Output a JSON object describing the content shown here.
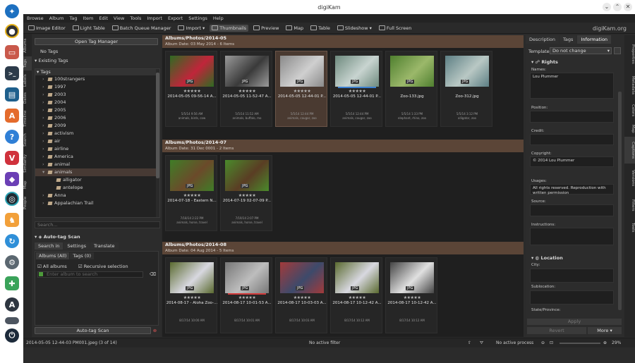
{
  "window": {
    "title": "digiKam"
  },
  "menu": [
    "Browse",
    "Album",
    "Tag",
    "Item",
    "Edit",
    "View",
    "Tools",
    "Import",
    "Export",
    "Settings",
    "Help"
  ],
  "toolbar": {
    "buttons": [
      "Image Editor",
      "Light Table",
      "Batch Queue Manager",
      "Import",
      "Thumbnails",
      "Preview",
      "Map",
      "Table",
      "Slideshow",
      "Full Screen"
    ],
    "brand": "digiKam.org"
  },
  "left_vtabs": [
    "Albums",
    "Tags",
    "Labels",
    "Dates",
    "Timeline",
    "Search",
    "Similarity",
    "Map",
    "People"
  ],
  "left_panel": {
    "open_tag_manager": "Open Tag Manager",
    "no_tags": "No Tags",
    "existing_tags": "Existing Tags",
    "tags_header": "Tags",
    "tags": [
      "100strangers",
      "1997",
      "2003",
      "2004",
      "2005",
      "2006",
      "2009",
      "activism",
      "air",
      "airline",
      "America",
      "animal",
      "animals",
      "alligator",
      "antelope",
      "Anna",
      "Appalachian Trail"
    ],
    "search_placeholder": "Search...",
    "auto_tag": {
      "title": "Auto-tag Scan",
      "tabs": [
        "Search in",
        "Settings",
        "Translate"
      ],
      "subtabs": [
        "Albums (All)",
        "Tags (0)"
      ],
      "all_albums": "All albums",
      "recursive": "Recursive selection",
      "search_placeholder": "Enter album to search",
      "scan_button": "Auto-tag Scan"
    }
  },
  "groups": [
    {
      "title": "Albums/Photos/2014-05",
      "subtitle": "Album Date: 03 May 2014 - 6 Items",
      "items": [
        {
          "name": "2014-05-05 09-56-14 A...",
          "date": "5/5/14 9:56 AM",
          "tags": "animals, birds, cow",
          "stars": "★★★★★",
          "colors": [
            "#2e6b22",
            "#c0253a"
          ]
        },
        {
          "name": "2014-05-05 11-52-47 A...",
          "date": "5/5/14 11:52 AM",
          "tags": "animals, buffalo, mo",
          "stars": "★★★★★",
          "colors": [
            "#9a9a9a",
            "#3a3a3a"
          ]
        },
        {
          "name": "2014-05-05 12-44-01 P...",
          "date": "5/5/14 12:44 PM",
          "tags": "animals, cougar, zoo",
          "stars": "★★★★★",
          "colors": [
            "#8a8a8a",
            "#cfcfcf"
          ]
        },
        {
          "name": "2014-05-05 12-44-01 P...",
          "date": "5/5/14 12:44 PM",
          "tags": "animals, cougar, zoo",
          "stars": "★★★★★",
          "colors": [
            "#6e8a7e",
            "#c8d4d0"
          ]
        },
        {
          "name": "Zoo-133.jpg",
          "date": "5/5/14 1:33 PM",
          "tags": "elephant, rhino, zoo",
          "stars": "",
          "colors": [
            "#4f7f2f",
            "#9bb86a"
          ]
        },
        {
          "name": "Zoo-312.jpg",
          "date": "5/5/14 3:12 PM",
          "tags": "alligator, zoo",
          "stars": "",
          "colors": [
            "#5d7f84",
            "#b9c8c4"
          ]
        }
      ]
    },
    {
      "title": "Albums/Photos/2014-07",
      "subtitle": "Album Date: 31 Dec 0001 - 2 Items",
      "items": [
        {
          "name": "2014-07-18 - Eastern N...",
          "date": "7/18/14 2:22 PM",
          "tags": "animals, horse, travel",
          "stars": "★★★★★",
          "colors": [
            "#3f7d27",
            "#6b4a2a"
          ]
        },
        {
          "name": "2014-07-19 02-07-09 P...",
          "date": "7/19/14 2:07 PM",
          "tags": "animals, horse, travel",
          "stars": "★★★★★",
          "colors": [
            "#4a8a2b",
            "#5a3d24"
          ]
        }
      ]
    },
    {
      "title": "Albums/Photos/2014-08",
      "subtitle": "Album Date: 04 Aug 2014 - 5 Items",
      "items": [
        {
          "name": "2014-08-17 - Aloha Zoo-...",
          "date": "8/17/14 10:00 AM",
          "tags": "",
          "stars": "★★★★★",
          "colors": [
            "#5a6a2f",
            "#d8d8e0"
          ]
        },
        {
          "name": "2014-08-17 10-01-53 A...",
          "date": "8/17/14 10:01 AM",
          "tags": "",
          "stars": "★★★★★",
          "colors": [
            "#777777",
            "#bdbdbd"
          ]
        },
        {
          "name": "2014-08-17 10-03-03 A...",
          "date": "8/17/14 10:03 AM",
          "tags": "",
          "stars": "★★★★★",
          "colors": [
            "#a23a3a",
            "#3d4a6b"
          ]
        },
        {
          "name": "2014-08-17 10-12-42 A...",
          "date": "8/17/14 10:12 AM",
          "tags": "",
          "stars": "★★★★★",
          "colors": [
            "#5a6a2f",
            "#d8d8e0"
          ]
        },
        {
          "name": "2014-08-17 10-12-42 A...",
          "date": "8/17/14 10:12 AM",
          "tags": "",
          "stars": "★★★★★",
          "colors": [
            "#444444",
            "#e0e0e0"
          ]
        }
      ]
    }
  ],
  "right_panel": {
    "tabs": [
      "Description",
      "Tags",
      "Information"
    ],
    "template_label": "Template:",
    "template_value": "Do not change",
    "rights_header": "Rights",
    "fields": [
      {
        "label": "Names:",
        "value": "Lou Plummer"
      },
      {
        "label": "Position:",
        "value": ""
      },
      {
        "label": "Credit:",
        "value": ""
      },
      {
        "label": "Copyright:",
        "value": "© 2014 Lou Plummer"
      },
      {
        "label": "Usages:",
        "value": "All rights reserved. Reproduction with written permission"
      },
      {
        "label": "Source:",
        "value": ""
      },
      {
        "label": "Instructions:",
        "value": ""
      }
    ],
    "location_header": "Location",
    "location_fields": [
      "City:",
      "Sublocation:",
      "State/Province:"
    ],
    "apply": "Apply",
    "revert": "Revert",
    "more": "More"
  },
  "right_vtabs": [
    "Properties",
    "Metadata",
    "Colors",
    "Map",
    "Captions",
    "Versions",
    "Filters",
    "Tools"
  ],
  "status": {
    "left": "2014-05-05 12-44-03 PM001.jpeg (3 of 14)",
    "filter": "No active filter",
    "process": "No active process",
    "zoom": "29%"
  }
}
